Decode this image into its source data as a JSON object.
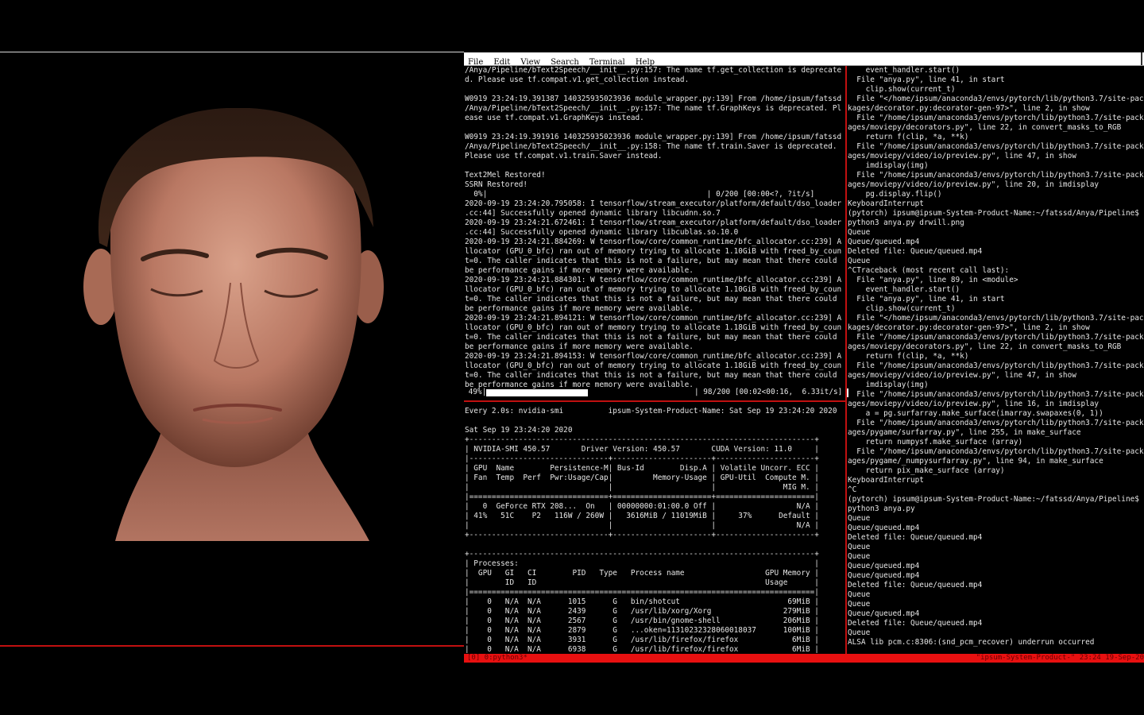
{
  "menu": [
    "File",
    "Edit",
    "View",
    "Search",
    "Terminal",
    "Help"
  ],
  "left_pane_lines": [
    "/Anya/Pipeline/bText2Speech/__init__.py:157: The name tf.get_collection is deprecate",
    "d. Please use tf.compat.v1.get_collection instead.",
    "",
    "W0919 23:24:19.391387 140325935023936 module_wrapper.py:139] From /home/ipsum/fatssd",
    "/Anya/Pipeline/bText2Speech/__init__.py:157: The name tf.GraphKeys is deprecated. Pl",
    "ease use tf.compat.v1.GraphKeys instead.",
    "",
    "W0919 23:24:19.391916 140325935023936 module_wrapper.py:139] From /home/ipsum/fatssd",
    "/Anya/Pipeline/bText2Speech/__init__.py:158: The name tf.train.Saver is deprecated.",
    "Please use tf.compat.v1.train.Saver instead.",
    "",
    "Text2Mel Restored!",
    "SSRN Restored!",
    "  0%|                                                 | 0/200 [00:00<?, ?it/s]",
    "2020-09-19 23:24:20.795058: I tensorflow/stream_executor/platform/default/dso_loader",
    ".cc:44] Successfully opened dynamic library libcudnn.so.7",
    "2020-09-19 23:24:21.672461: I tensorflow/stream_executor/platform/default/dso_loader",
    ".cc:44] Successfully opened dynamic library libcublas.so.10.0",
    "2020-09-19 23:24:21.884269: W tensorflow/core/common_runtime/bfc_allocator.cc:239] A",
    "llocator (GPU_0_bfc) ran out of memory trying to allocate 1.10GiB with freed_by_coun",
    "t=0. The caller indicates that this is not a failure, but may mean that there could",
    "be performance gains if more memory were available.",
    "2020-09-19 23:24:21.884301: W tensorflow/core/common_runtime/bfc_allocator.cc:239] A",
    "llocator (GPU_0_bfc) ran out of memory trying to allocate 1.10GiB with freed_by_coun",
    "t=0. The caller indicates that this is not a failure, but may mean that there could",
    "be performance gains if more memory were available.",
    "2020-09-19 23:24:21.894121: W tensorflow/core/common_runtime/bfc_allocator.cc:239] A",
    "llocator (GPU_0_bfc) ran out of memory trying to allocate 1.18GiB with freed_by_coun",
    "t=0. The caller indicates that this is not a failure, but may mean that there could",
    "be performance gains if more memory were available.",
    "2020-09-19 23:24:21.894153: W tensorflow/core/common_runtime/bfc_allocator.cc:239] A",
    "llocator (GPU_0_bfc) ran out of memory trying to allocate 1.18GiB with freed_by_coun",
    "t=0. The caller indicates that this is not a failure, but may mean that there could",
    "be performance gains if more memory were available."
  ],
  "progress": {
    "percent_text": " 49%|",
    "fraction": 0.49,
    "tail_text": "| 98/200 [00:02<00:16,  6.33it/s]"
  },
  "bottom_pane_lines": [
    "Every 2.0s: nvidia-smi          ipsum-System-Product-Name: Sat Sep 19 23:24:20 2020",
    "",
    "Sat Sep 19 23:24:20 2020",
    "+-----------------------------------------------------------------------------+",
    "| NVIDIA-SMI 450.57       Driver Version: 450.57       CUDA Version: 11.0     |",
    "|-------------------------------+----------------------+----------------------+",
    "| GPU  Name        Persistence-M| Bus-Id        Disp.A | Volatile Uncorr. ECC |",
    "| Fan  Temp  Perf  Pwr:Usage/Cap|         Memory-Usage | GPU-Util  Compute M. |",
    "|                               |                      |               MIG M. |",
    "|===============================+======================+======================|",
    "|   0  GeForce RTX 208...  On   | 00000000:01:00.0 Off |                  N/A |",
    "| 41%   51C    P2   116W / 260W |   3616MiB / 11019MiB |     37%      Default |",
    "|                               |                      |                  N/A |",
    "+-------------------------------+----------------------+----------------------+",
    "",
    "+-----------------------------------------------------------------------------+",
    "| Processes:                                                                  |",
    "|  GPU   GI   CI        PID   Type   Process name                  GPU Memory |",
    "|        ID   ID                                                   Usage      |",
    "|=============================================================================|",
    "|    0   N/A  N/A      1015      G   bin/shotcut                        69MiB |",
    "|    0   N/A  N/A      2439      G   /usr/lib/xorg/Xorg                279MiB |",
    "|    0   N/A  N/A      2567      G   /usr/bin/gnome-shell              206MiB |",
    "|    0   N/A  N/A      2879      G   ...oken=11310232328060018037      100MiB |",
    "|    0   N/A  N/A      3931      G   /usr/lib/firefox/firefox            6MiB |",
    "|    0   N/A  N/A      6938      G   /usr/lib/firefox/firefox            6MiB |"
  ],
  "right_pane_lines": [
    "    event_handler.start()",
    "  File \"anya.py\", line 41, in start",
    "    clip.show(current_t)",
    "  File \"</home/ipsum/anaconda3/envs/pytorch/lib/python3.7/site-pac",
    "kages/decorator.py:decorator-gen-97>\", line 2, in show",
    "  File \"/home/ipsum/anaconda3/envs/pytorch/lib/python3.7/site-pack",
    "ages/moviepy/decorators.py\", line 22, in convert_masks_to_RGB",
    "    return f(clip, *a, **k)",
    "  File \"/home/ipsum/anaconda3/envs/pytorch/lib/python3.7/site-pack",
    "ages/moviepy/video/io/preview.py\", line 47, in show",
    "    imdisplay(img)",
    "  File \"/home/ipsum/anaconda3/envs/pytorch/lib/python3.7/site-pack",
    "ages/moviepy/video/io/preview.py\", line 20, in imdisplay",
    "    pg.display.flip()",
    "KeyboardInterrupt",
    "(pytorch) ipsum@ipsum-System-Product-Name:~/fatssd/Anya/Pipeline$",
    "python3 anya.py drwill.png",
    "Queue",
    "Queue/queued.mp4",
    "Deleted file: Queue/queued.mp4",
    "Queue",
    "^CTraceback (most recent call last):",
    "  File \"anya.py\", line 89, in <module>",
    "    event_handler.start()",
    "  File \"anya.py\", line 41, in start",
    "    clip.show(current_t)",
    "  File \"</home/ipsum/anaconda3/envs/pytorch/lib/python3.7/site-pac",
    "kages/decorator.py:decorator-gen-97>\", line 2, in show",
    "  File \"/home/ipsum/anaconda3/envs/pytorch/lib/python3.7/site-pack",
    "ages/moviepy/decorators.py\", line 22, in convert_masks_to_RGB",
    "    return f(clip, *a, **k)",
    "  File \"/home/ipsum/anaconda3/envs/pytorch/lib/python3.7/site-pack",
    "ages/moviepy/video/io/preview.py\", line 47, in show",
    "    imdisplay(img)",
    "  File \"/home/ipsum/anaconda3/envs/pytorch/lib/python3.7/site-pack",
    "ages/moviepy/video/io/preview.py\", line 16, in imdisplay",
    "    a = pg.surfarray.make_surface(imarray.swapaxes(0, 1))",
    "  File \"/home/ipsum/anaconda3/envs/pytorch/lib/python3.7/site-pack",
    "ages/pygame/surfarray.py\", line 255, in make_surface",
    "    return numpysf.make_surface (array)",
    "  File \"/home/ipsum/anaconda3/envs/pytorch/lib/python3.7/site-pack",
    "ages/pygame/_numpysurfarray.py\", line 94, in make_surface",
    "    return pix_make_surface (array)",
    "KeyboardInterrupt",
    "^C",
    "(pytorch) ipsum@ipsum-System-Product-Name:~/fatssd/Anya/Pipeline$",
    "python3 anya.py",
    "Queue",
    "Queue/queued.mp4",
    "Deleted file: Queue/queued.mp4",
    "Queue",
    "Queue",
    "Queue/queued.mp4",
    "Queue/queued.mp4",
    "Deleted file: Queue/queued.mp4",
    "Queue",
    "Queue",
    "Queue/queued.mp4",
    "Deleted file: Queue/queued.mp4",
    "Queue",
    "ALSA lib pcm.c:8306:(snd_pcm_recover) underrun occurred"
  ],
  "status_bar": {
    "left": "[0] 0:python3*",
    "right": "\"ipsum-System-Product-\" 23:24 19-Sep-20"
  }
}
